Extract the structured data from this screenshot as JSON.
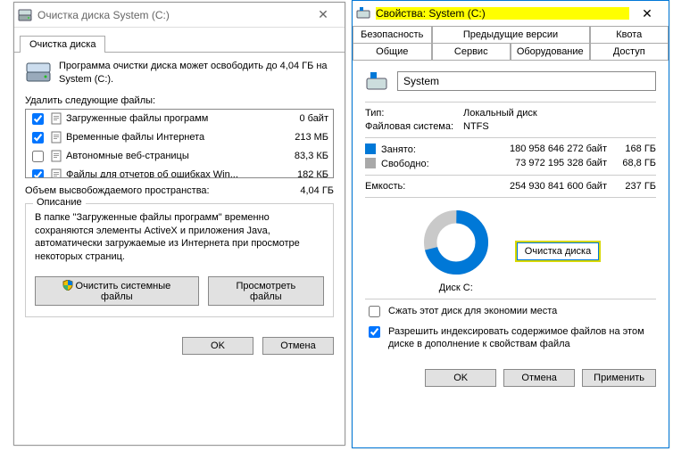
{
  "left": {
    "title": "Очистка диска System (C:)",
    "tab": "Очистка диска",
    "info": "Программа очистки диска может освободить до 4,04 ГБ на System (C:).",
    "delete_label": "Удалить следующие файлы:",
    "files": [
      {
        "checked": true,
        "name": "Загруженные файлы программ",
        "size": "0 байт"
      },
      {
        "checked": true,
        "name": "Временные файлы Интернета",
        "size": "213 МБ"
      },
      {
        "checked": false,
        "name": "Автономные веб-страницы",
        "size": "83,3 КБ"
      },
      {
        "checked": true,
        "name": "Файлы для отчетов об ошибках Win...",
        "size": "182 КБ"
      }
    ],
    "total_label": "Объем высвобождаемого пространства:",
    "total_value": "4,04 ГБ",
    "group_title": "Описание",
    "desc": "В папке \"Загруженные файлы программ\" временно сохраняются элементы ActiveX и приложения Java, автоматически загружаемые из Интернета при просмотре некоторых страниц.",
    "btn_sys": "Очистить системные файлы",
    "btn_view": "Просмотреть файлы",
    "btn_ok": "OK",
    "btn_cancel": "Отмена"
  },
  "right": {
    "title": "Свойства: System (C:)",
    "tabs_row1": [
      "Безопасность",
      "Предыдущие версии",
      "Квота"
    ],
    "tabs_row2": [
      "Общие",
      "Сервис",
      "Оборудование",
      "Доступ"
    ],
    "drive_name": "System",
    "type_label": "Тип:",
    "type_value": "Локальный диск",
    "fs_label": "Файловая система:",
    "fs_value": "NTFS",
    "used_label": "Занято:",
    "used_bytes": "180 958 646 272 байт",
    "used_h": "168 ГБ",
    "free_label": "Свободно:",
    "free_bytes": "73 972 195 328 байт",
    "free_h": "68,8 ГБ",
    "cap_label": "Емкость:",
    "cap_bytes": "254 930 841 600 байт",
    "cap_h": "237 ГБ",
    "disk_label": "Диск C:",
    "cleanup_btn": "Очистка диска",
    "chk_compress": "Сжать этот диск для экономии места",
    "chk_index": "Разрешить индексировать содержимое файлов на этом диске в дополнение к свойствам файла",
    "btn_ok": "OK",
    "btn_cancel": "Отмена",
    "btn_apply": "Применить",
    "used_pct": 71
  }
}
